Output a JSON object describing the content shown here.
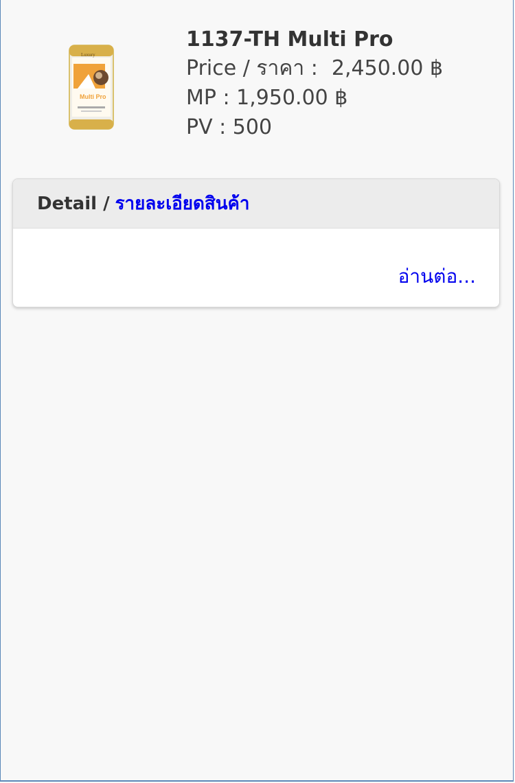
{
  "product": {
    "title": "1137-TH  Multi Pro",
    "price_label": "Price / ราคา :",
    "price_value": "2,450.00 ฿",
    "mp_text": "MP : 1,950.00 ฿",
    "pv_text": "PV : 500",
    "image_brand": "Luxury",
    "image_name": "Multi Pro"
  },
  "detail": {
    "title_en": "Detail /",
    "title_th": "รายละเอียดสินค้า",
    "read_more": "อ่านต่อ..."
  }
}
